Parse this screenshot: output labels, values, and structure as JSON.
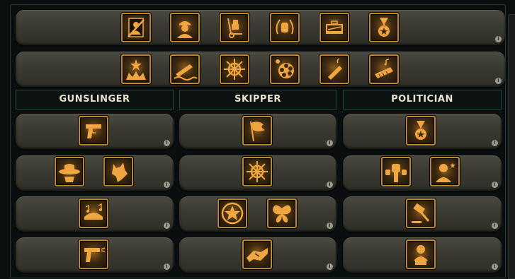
{
  "columns": {
    "gunslinger": "GUNSLINGER",
    "skipper": "SKIPPER",
    "politician": "POLITICIAN"
  },
  "info_glyph": "i",
  "perk_rows": [
    [
      "portrait-cancel-icon",
      "soldier-bust-icon",
      "hand-truck-icon",
      "laurel-fist-icon",
      "briefcase-money-icon",
      "medal-icon"
    ],
    [
      "battle-star-icon",
      "sinking-ship-icon",
      "ship-wheel-icon",
      "revolver-cylinder-icon",
      "cigar-icon",
      "harmonica-icon"
    ]
  ],
  "colors": {
    "accent_gold": "#c08a2c",
    "panel": "#3a3a32",
    "header_border": "#1e4e46",
    "header_text": "#e8e2cc"
  }
}
